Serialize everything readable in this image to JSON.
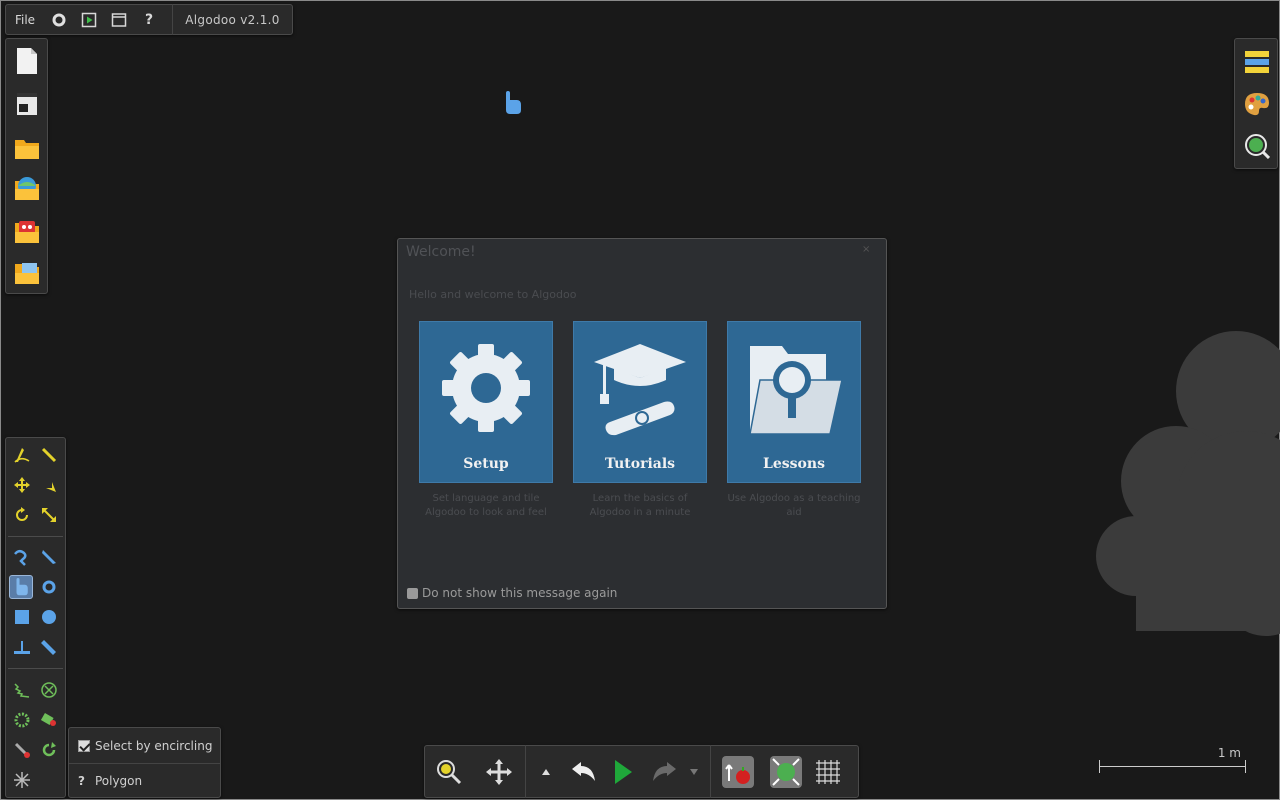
{
  "menu": {
    "file_label": "File",
    "version": "Algodoo v2.1.0",
    "icons": [
      "gear-icon",
      "play-scene-icon",
      "window-icon",
      "help-icon"
    ],
    "help_glyph": "?"
  },
  "file_toolbar": {
    "items": [
      "new-scene-icon",
      "scene-template-icon",
      "open-folder-icon",
      "algobox-folder-icon",
      "lessons-folder-icon",
      "browse-folder-icon"
    ]
  },
  "right_toolbar": {
    "items": [
      "layers-icon",
      "palette-icon",
      "zoom-to-scene-icon"
    ]
  },
  "tools": {
    "items": [
      "sketch-tool",
      "cut-tool",
      "move-tool",
      "drag-tool",
      "rotate-tool",
      "scale-tool",
      "brush-tool",
      "knife-tool",
      "hand-tool",
      "gear-tool",
      "box-tool",
      "circle-tool",
      "fixate-tool",
      "plane-tool",
      "spring-tool",
      "axle-tool",
      "gear-wheel-tool",
      "thruster-tool",
      "tracer-tool",
      "chain-tool",
      "laser-tool"
    ],
    "active": "hand-tool"
  },
  "options": {
    "select_by_encircling": "Select by encircling",
    "select_by_encircling_checked": true,
    "polygon_label": "Polygon",
    "help_glyph": "?"
  },
  "dialog": {
    "title": "Welcome!",
    "close_glyph": "×",
    "subtitle": "Hello and welcome to Algodoo",
    "cards": [
      {
        "label": "Setup",
        "description": "Set language and tile Algodoo to look and feel"
      },
      {
        "label": "Tutorials",
        "description": "Learn the basics of Algodoo in a minute"
      },
      {
        "label": "Lessons",
        "description": "Use Algodoo as a teaching aid"
      }
    ],
    "dont_show_label": "Do not show this message again",
    "dont_show_checked": false
  },
  "playbar": {
    "items": [
      "zoom-icon",
      "pan-icon",
      "up-arrow-icon",
      "undo-icon",
      "play-icon",
      "redo-icon",
      "down-arrow-icon",
      "gravity-icon",
      "air-friction-icon",
      "grid-icon"
    ]
  },
  "scale": {
    "label": "1 m"
  },
  "colors": {
    "background": "#191919",
    "card": "#2e6894",
    "play": "#1fa83a",
    "accent_yellow": "#e3d22b",
    "accent_blue": "#5ba3e8"
  }
}
